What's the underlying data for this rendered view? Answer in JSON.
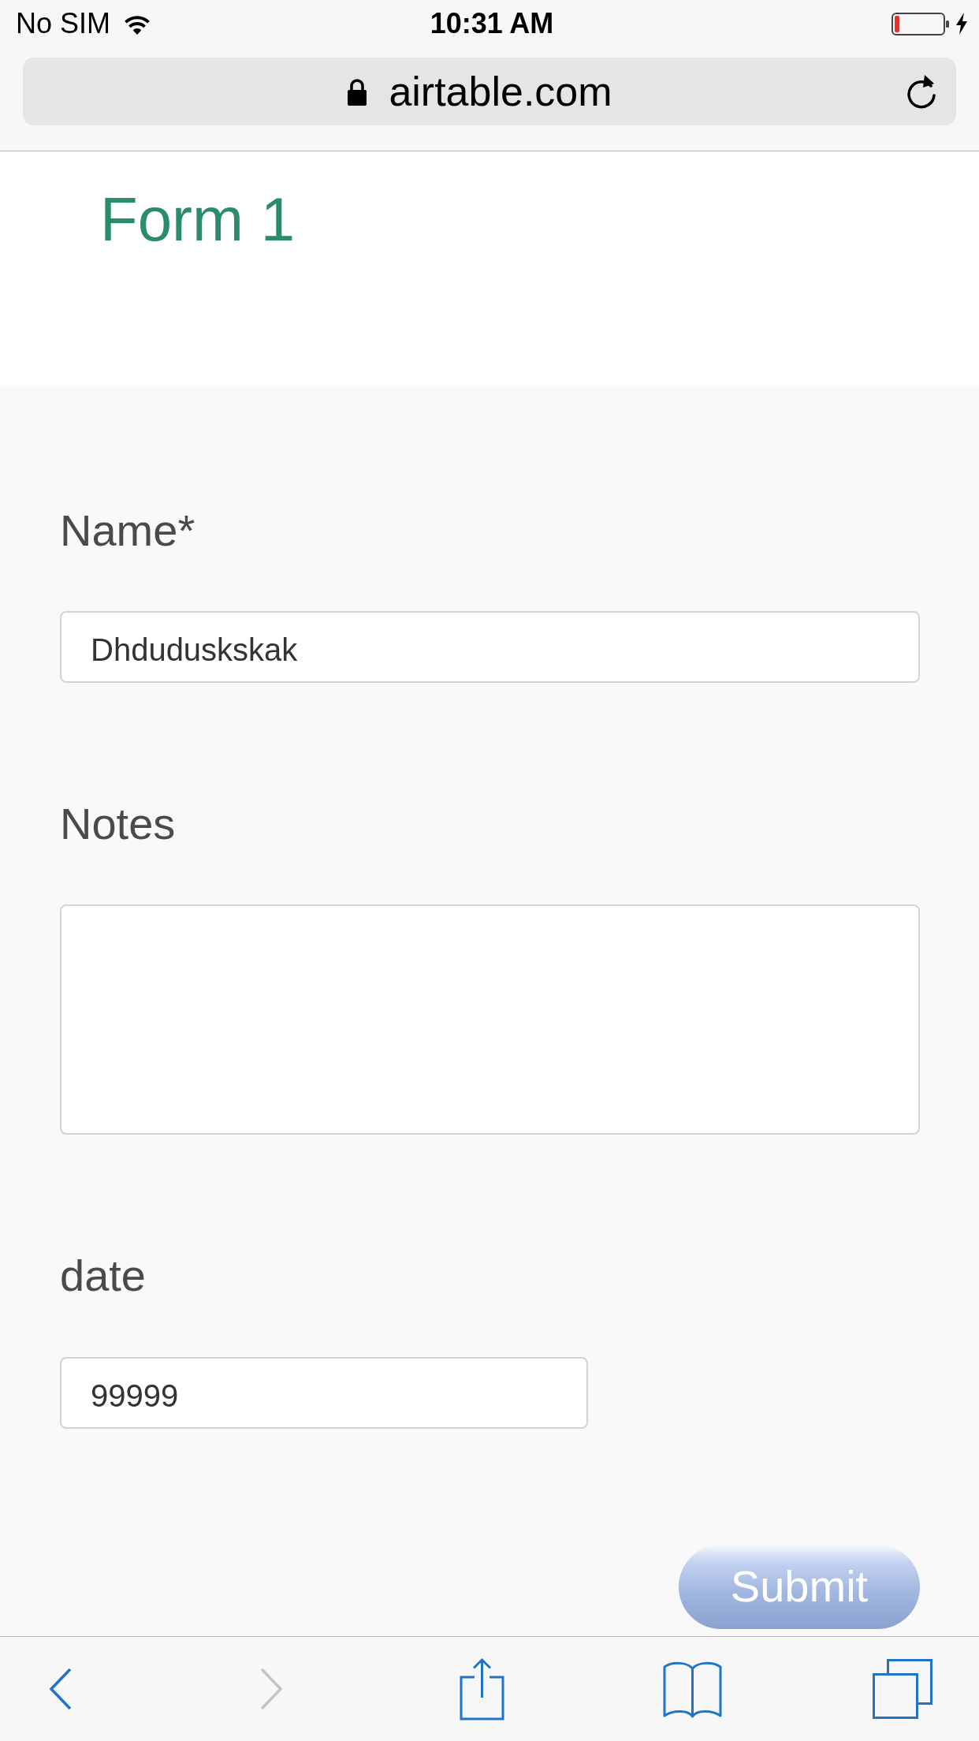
{
  "status_bar": {
    "carrier": "No SIM",
    "time": "10:31 AM"
  },
  "address_bar": {
    "url": "airtable.com"
  },
  "form": {
    "title": "Form 1",
    "fields": [
      {
        "kind": "text",
        "label": "Name*",
        "value": "Dhduduskskak"
      },
      {
        "kind": "long_text",
        "label": "Notes"
      },
      {
        "kind": "short_text",
        "label": "date",
        "value": "99999"
      }
    ],
    "submit": {
      "label": "Submit"
    }
  },
  "toolbar": [
    {
      "kind": "back",
      "disabled": false
    },
    {
      "kind": "forward",
      "disabled": true
    },
    {
      "kind": "share",
      "disabled": false
    },
    {
      "kind": "bookmarks",
      "disabled": false
    },
    {
      "kind": "tabs",
      "disabled": false
    }
  ]
}
